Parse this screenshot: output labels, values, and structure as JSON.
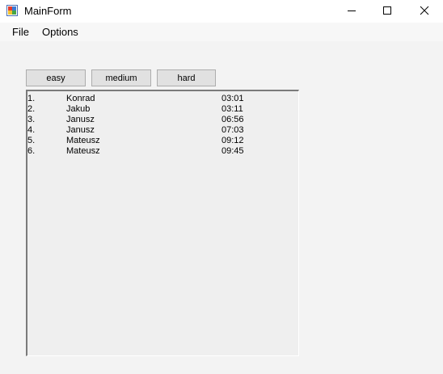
{
  "window": {
    "title": "MainForm",
    "controls": {
      "minimize": "minimize-icon",
      "maximize": "maximize-icon",
      "close": "close-icon"
    }
  },
  "menu": {
    "items": [
      "File",
      "Options"
    ]
  },
  "difficulty_buttons": [
    "easy",
    "medium",
    "hard"
  ],
  "scores": [
    {
      "rank": "1.",
      "name": "Konrad",
      "time": "03:01"
    },
    {
      "rank": "2.",
      "name": "Jakub",
      "time": "03:11"
    },
    {
      "rank": "3.",
      "name": "Janusz",
      "time": "06:56"
    },
    {
      "rank": "4.",
      "name": "Janusz",
      "time": "07:03"
    },
    {
      "rank": "5.",
      "name": "Mateusz",
      "time": "09:12"
    },
    {
      "rank": "6.",
      "name": "Mateusz",
      "time": "09:45"
    }
  ]
}
